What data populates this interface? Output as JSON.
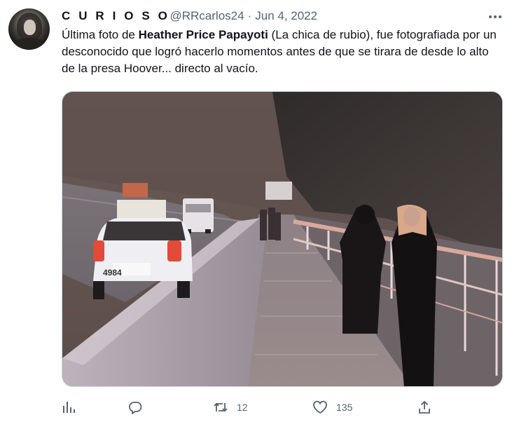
{
  "tweet": {
    "author": {
      "display_name": "C U R I O S O",
      "handle": "@RRcarlos24",
      "separator": "·",
      "date": "Jun 4, 2022",
      "avatar_icon": "profile-photo"
    },
    "text": {
      "part1": "Última foto de ",
      "bold": "Heather Price Papayoti",
      "part2": " (La chica de rubio), fue fotografiada por un desconocido que logró hacerlo momentos antes de que se tirara de desde lo alto de la presa Hoover... directo al vacío."
    },
    "media": {
      "license_plate": "4984"
    },
    "actions": {
      "views_icon": "analytics-icon",
      "reply_icon": "reply-icon",
      "retweet_icon": "retweet-icon",
      "retweet_count": "12",
      "like_icon": "heart-icon",
      "like_count": "135",
      "share_icon": "share-icon"
    }
  },
  "colors": {
    "text_primary": "#0f1419",
    "text_secondary": "#536471",
    "border": "#cfd9de"
  }
}
